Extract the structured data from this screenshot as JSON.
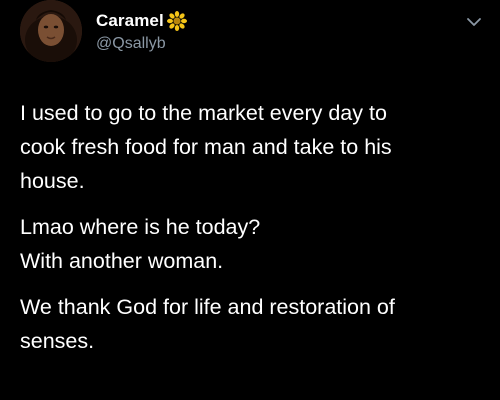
{
  "user": {
    "display_name": "Caramel",
    "handle": "@Qsallyb",
    "badge_icon": "sunflower-icon"
  },
  "menu_icon": "chevron-down-icon",
  "tweet": {
    "paragraphs": [
      [
        "I used to go to the market every day  to",
        "cook fresh food for man and take to his",
        "house."
      ],
      [
        "Lmao where is he today?",
        "With another woman."
      ],
      [
        "We thank God for life and restoration of",
        "senses."
      ]
    ]
  },
  "colors": {
    "background": "#000000",
    "text": "#ffffff",
    "handle": "#8b98a5",
    "sunflower": "#f5c518"
  }
}
